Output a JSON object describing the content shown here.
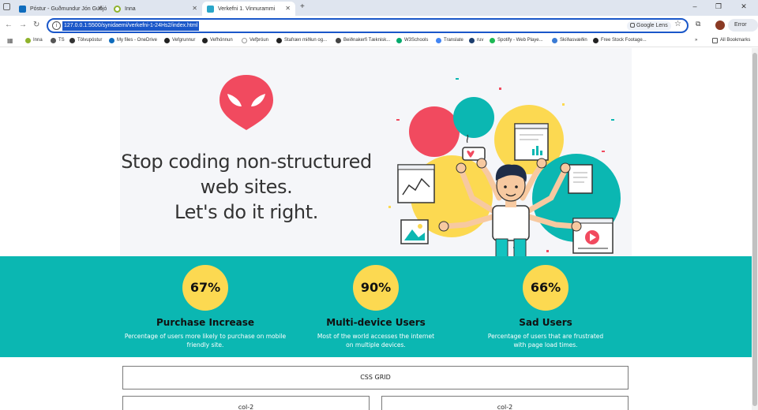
{
  "browser": {
    "tabs": [
      {
        "title": "Póstur - Guðmundur Jón Guðjó",
        "icon": "outlook-icon",
        "color": "#0f6cbd"
      },
      {
        "title": "Inna",
        "icon": "inna-icon",
        "color": "#8fb32c"
      },
      {
        "title": "Verkefni 1. Vinnurammi",
        "icon": "vscode-icon",
        "color": "#2aa6c9"
      }
    ],
    "new_tab": "+",
    "url": "127.0.0.1:5500/synidaemi/verkefni-1-24Hs2/index.html",
    "lens_label": "Google Lens",
    "error_label": "Error",
    "bookmarks": [
      {
        "label": "Inna",
        "color": "#8fb32c"
      },
      {
        "label": "TS",
        "color": "#555555"
      },
      {
        "label": "Tölvupóstur",
        "color": "#333333"
      },
      {
        "label": "My files - OneDrive",
        "color": "#0f6cbd"
      },
      {
        "label": "Vefgrunnur",
        "color": "#222222"
      },
      {
        "label": "Vefhönnun",
        "color": "#222222"
      },
      {
        "label": "Vefþróun",
        "color": "#ffffff"
      },
      {
        "label": "Stafræn miðlun og...",
        "color": "#222222"
      },
      {
        "label": "Beiðnakerfi Tæknisk...",
        "color": "#444444"
      },
      {
        "label": "W3Schools",
        "color": "#04aa6d"
      },
      {
        "label": "Translate",
        "color": "#4285f4"
      },
      {
        "label": "ruv",
        "color": "#1c3e6e"
      },
      {
        "label": "Spotify - Web Playe...",
        "color": "#1db954"
      },
      {
        "label": "Skíðasvæðin",
        "color": "#3a7bd5"
      },
      {
        "label": "Free Stock Footage...",
        "color": "#222222"
      }
    ],
    "bookmarks_more": "»",
    "all_bookmarks": "All Bookmarks"
  },
  "hero": {
    "headline_lines": [
      "Stop coding non-structured",
      "web sites.",
      "Let's do it right."
    ],
    "logo_color": "#f14a5f"
  },
  "stats": [
    {
      "value": "67%",
      "title": "Purchase Increase",
      "desc_lines": [
        "Percentage of users more likely to purchase on mobile",
        "friendly site."
      ]
    },
    {
      "value": "90%",
      "title": "Multi-device Users",
      "desc_lines": [
        "Most of the world accesses the internet",
        "on multiple devices."
      ]
    },
    {
      "value": "66%",
      "title": "Sad Users",
      "desc_lines": [
        "Percentage of users that are frustrated",
        "with page load times."
      ]
    }
  ],
  "grid": {
    "header": "CSS GRID",
    "cols": [
      "col-2",
      "col-2"
    ]
  },
  "colors": {
    "teal": "#0bb7b2",
    "yellow": "#fcd951",
    "red": "#f14a5f",
    "hero_bg": "#f5f6f9"
  }
}
